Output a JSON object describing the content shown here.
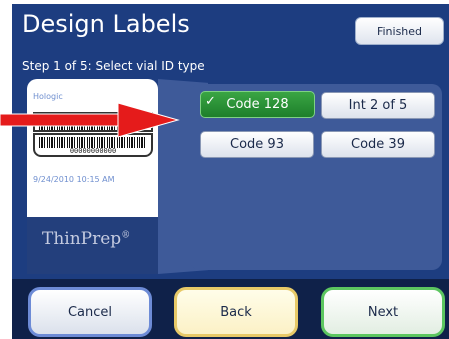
{
  "header": {
    "title": "Design Labels",
    "finished_label": "Finished"
  },
  "step": {
    "text": "Step 1 of 5: Select vial ID type"
  },
  "label_preview": {
    "maker": "Hologic",
    "barcode_digits": "00000000000",
    "datetime": "9/24/2010 10:15 AM",
    "brand": "ThinPrep",
    "brand_mark": "®"
  },
  "id_types": {
    "options": [
      {
        "label": "Code 128",
        "selected": true
      },
      {
        "label": "Int 2 of 5",
        "selected": false
      },
      {
        "label": "Code 93",
        "selected": false
      },
      {
        "label": "Code 39",
        "selected": false
      }
    ],
    "check_glyph": "✓"
  },
  "nav": {
    "cancel_label": "Cancel",
    "back_label": "Back",
    "next_label": "Next"
  },
  "colors": {
    "screen_bg": "#1d3d80",
    "panel_bg": "#3e5a99",
    "selected_green": "#2b9a36",
    "arrow_red": "#e51b1b",
    "cancel_border": "#6d8bd6",
    "back_border": "#e7c968",
    "next_border": "#5cc660"
  },
  "icons": {
    "check": "check-icon",
    "arrow": "red-arrow-icon"
  }
}
